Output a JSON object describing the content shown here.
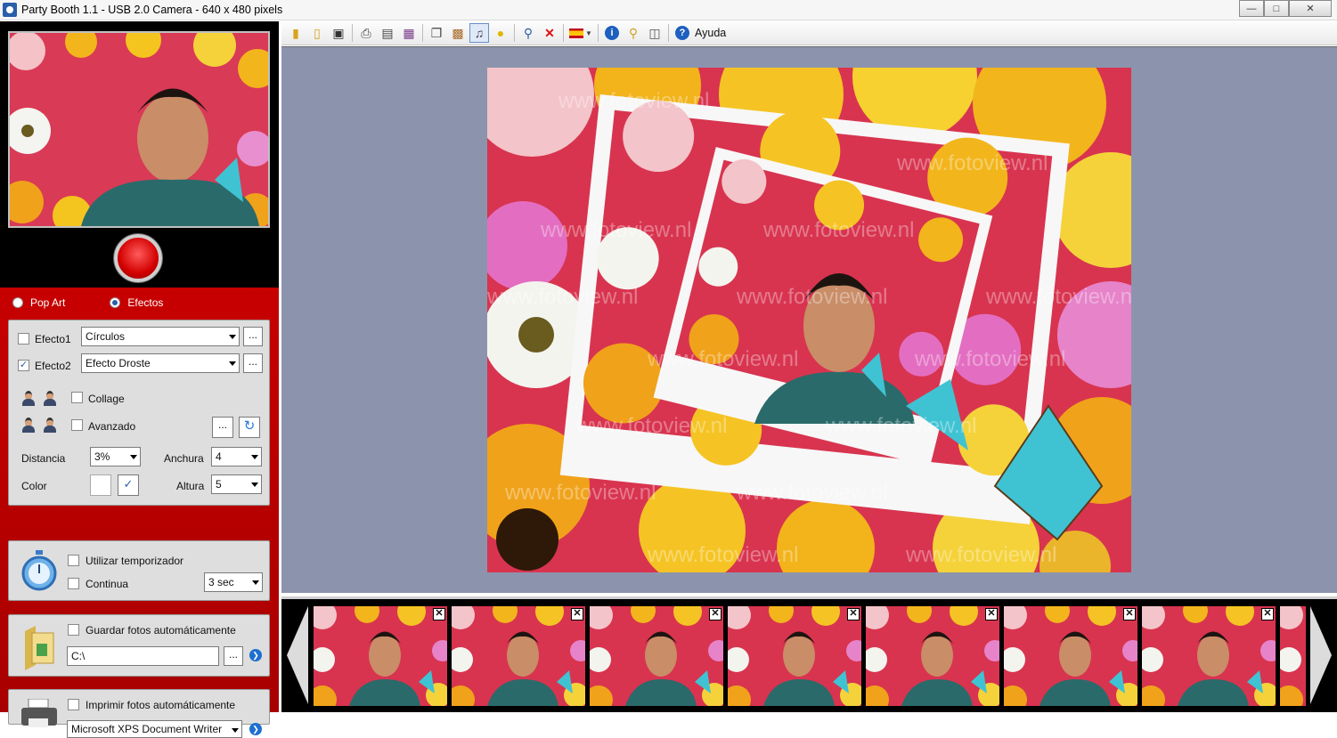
{
  "window": {
    "title": "Party Booth 1.1 - USB 2.0 Camera - 640 x 480 pixels"
  },
  "mode": {
    "options": [
      "Pop Art",
      "Efectos"
    ],
    "selected": "Efectos"
  },
  "effects": {
    "efecto1_label": "Efecto1",
    "efecto1_checked": false,
    "efecto1_value": "Círculos",
    "efecto2_label": "Efecto2",
    "efecto2_checked": true,
    "efecto2_value": "Efecto Droste",
    "dots": "...",
    "collage_label": "Collage",
    "avanzado_label": "Avanzado",
    "distancia_label": "Distancia",
    "distancia_value": "3%",
    "anchura_label": "Anchura",
    "anchura_value": "4",
    "color_label": "Color",
    "altura_label": "Altura",
    "altura_value": "5"
  },
  "timer": {
    "utilizar_label": "Utilizar temporizador",
    "continua_label": "Continua",
    "interval_value": "3 sec"
  },
  "save": {
    "label": "Guardar fotos automáticamente",
    "path": "C:\\"
  },
  "print": {
    "label": "Imprimir fotos automáticamente",
    "printer": "Microsoft XPS Document Writer"
  },
  "toolbar": {
    "help_label": "Ayuda"
  },
  "colors": {
    "red_panel": "#b80000",
    "canvas_bg": "#8c94ad",
    "accent": "#2a5ea8"
  },
  "thumbnails": {
    "count": 8,
    "remove_glyph": "✕"
  }
}
